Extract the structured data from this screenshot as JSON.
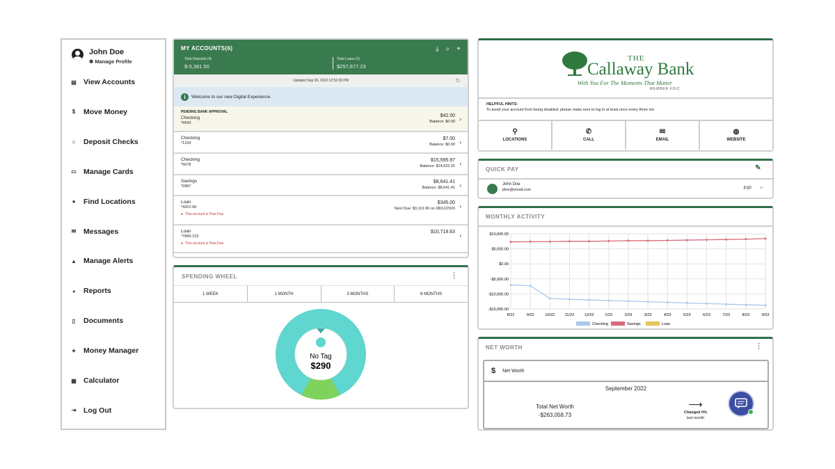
{
  "sidebar": {
    "user_name": "John Doe",
    "manage_profile": "Manage Profile",
    "items": [
      {
        "label": "View Accounts",
        "icon": "accounts-icon"
      },
      {
        "label": "Move Money",
        "icon": "transfer-icon"
      },
      {
        "label": "Deposit Checks",
        "icon": "bank-icon"
      },
      {
        "label": "Manage Cards",
        "icon": "card-icon"
      },
      {
        "label": "Find Locations",
        "icon": "location-pin-icon"
      },
      {
        "label": "Messages",
        "icon": "mail-icon"
      },
      {
        "label": "Manage Alerts",
        "icon": "bell-icon"
      },
      {
        "label": "Reports",
        "icon": "pie-chart-icon"
      },
      {
        "label": "Documents",
        "icon": "document-icon"
      },
      {
        "label": "Money Manager",
        "icon": "money-manager-icon"
      },
      {
        "label": "Calculator",
        "icon": "calculator-icon"
      },
      {
        "label": "Log Out",
        "icon": "logout-icon"
      }
    ]
  },
  "accounts": {
    "title": "MY ACCOUNTS(6)",
    "deposits_label": "Total Deposits (4)",
    "deposits_value": "$-5,381.50",
    "loans_label": "Total Loans (2)",
    "loans_value": "$257,677.23",
    "updated": "Updated Sep 30, 2022 12:52:39 PM",
    "welcome": "Welcome to our new Digital Experience.",
    "pending_label": "PENDING BANK APPROVAL",
    "rows": [
      {
        "name": "Checking",
        "number": "*6543",
        "amount": "$42.00",
        "balance": "Balance: $0.00"
      },
      {
        "name": "Checking",
        "number": "*1234",
        "amount": "$7.00",
        "balance": "Balance: $0.00"
      },
      {
        "name": "Checking",
        "number": "*5678",
        "amount": "$15,595.97",
        "balance": "Balance: $14,022.91"
      },
      {
        "name": "Savings",
        "number": "*0987",
        "amount": "$8,641.41",
        "balance": "Balance: $8,641.41"
      },
      {
        "name": "Loan",
        "number": "*4321-90",
        "amount": "$345.00",
        "balance": "Next Due: $3,101.96 on 08/12/2020",
        "warning": "This account is Past Due"
      },
      {
        "name": "Loan",
        "number": "*7890-123",
        "amount": "$10,718.63",
        "balance": "",
        "warning": "This account is Past Due"
      }
    ]
  },
  "spending": {
    "title": "SPENDING WHEEL",
    "tabs": [
      "1 WEEK",
      "1 MONTH",
      "3 MONTHS",
      "6 MONTHS"
    ],
    "center_label": "No Tag",
    "center_value": "$290",
    "colors": {
      "main": "#5fd6cf",
      "accent": "#7fd35c"
    }
  },
  "bank": {
    "name_the": "THE",
    "name": "Callaway Bank",
    "tagline": "With You For The Moments That Matter",
    "fdic": "MEMBER FDIC",
    "hints_title": "HELPFUL HINTS:",
    "hints_text": "To avoid your account from being disabled, please make sure to log in at least once every three mo",
    "links": [
      {
        "label": "LOCATIONS",
        "icon": "location-pin-icon"
      },
      {
        "label": "CALL",
        "icon": "phone-icon"
      },
      {
        "label": "EMAIL",
        "icon": "mail-icon"
      },
      {
        "label": "WEBSITE",
        "icon": "globe-icon"
      }
    ]
  },
  "quickpay": {
    "title": "QUICK PAY",
    "name": "John Doe",
    "email": "jdoe@email.com",
    "method": "P2P"
  },
  "monthly": {
    "title": "MONTHLY ACTIVITY"
  },
  "networth": {
    "title": "NET WORTH",
    "row_label": "Net Worth",
    "month": "September 2022",
    "total_label": "Total Net Worth",
    "total_value": "-$263,058.73",
    "changed": "Changed 0%",
    "last_month": "last month"
  },
  "chart_data": {
    "type": "line",
    "title": "",
    "x": [
      "8/22",
      "9/22",
      "10/22",
      "11/22",
      "12/22",
      "1/23",
      "2/23",
      "3/23",
      "4/23",
      "5/23",
      "6/23",
      "7/23",
      "8/23",
      "9/23"
    ],
    "ylim": [
      -15000,
      10000
    ],
    "yticks": [
      "$10,000.00",
      "$5,000.00",
      "$0.00",
      "-$5,000.00",
      "-$10,000.00",
      "-$15,000.00"
    ],
    "series": [
      {
        "name": "Checking",
        "color": "#a9c8ea",
        "values": [
          -7000,
          -7300,
          -11500,
          -11800,
          -12000,
          -12200,
          -12400,
          -12600,
          -12800,
          -13000,
          -13200,
          -13400,
          -13600,
          -13800
        ]
      },
      {
        "name": "Savings",
        "color": "#d86a7a",
        "values": [
          7300,
          7400,
          7400,
          7500,
          7500,
          7600,
          7700,
          7700,
          7800,
          7900,
          8000,
          8100,
          8200,
          8400
        ]
      },
      {
        "name": "Loan",
        "color": "#e5c55a",
        "values": []
      }
    ]
  }
}
